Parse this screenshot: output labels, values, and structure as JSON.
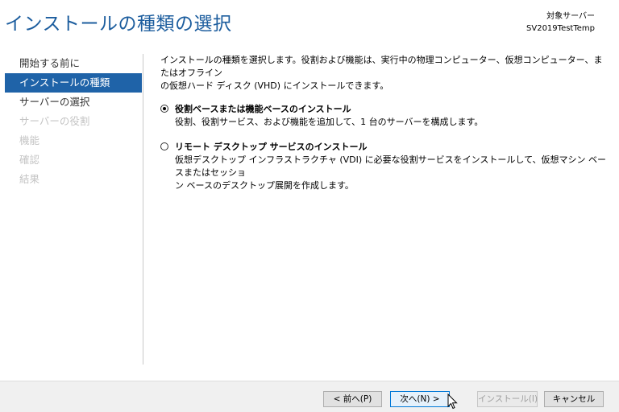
{
  "header": {
    "title": "インストールの種類の選択",
    "destination_label": "対象サーバー",
    "destination_server": "SV2019TestTemp"
  },
  "nav": {
    "items": [
      {
        "label": "開始する前に",
        "state": "normal"
      },
      {
        "label": "インストールの種類",
        "state": "active"
      },
      {
        "label": "サーバーの選択",
        "state": "normal"
      },
      {
        "label": "サーバーの役割",
        "state": "disabled"
      },
      {
        "label": "機能",
        "state": "disabled"
      },
      {
        "label": "確認",
        "state": "disabled"
      },
      {
        "label": "結果",
        "state": "disabled"
      }
    ]
  },
  "main": {
    "intro_line1": "インストールの種類を選択します。役割および機能は、実行中の物理コンピューター、仮想コンピューター、またはオフライン",
    "intro_line2": "の仮想ハード ディスク (VHD) にインストールできます。",
    "options": [
      {
        "title": "役割ベースまたは機能ベースのインストール",
        "desc_line1": "役割、役割サービス、および機能を追加して、1 台のサーバーを構成します。",
        "desc_line2": "",
        "selected": true
      },
      {
        "title": "リモート デスクトップ サービスのインストール",
        "desc_line1": "仮想デスクトップ インフラストラクチャ (VDI) に必要な役割サービスをインストールして、仮想マシン ベースまたはセッショ",
        "desc_line2": "ン ベースのデスクトップ展開を作成します。",
        "selected": false
      }
    ]
  },
  "footer": {
    "prev_label": "< 前へ(P)",
    "next_label": "次へ(N) >",
    "install_label": "インストール(I)",
    "cancel_label": "キャンセル"
  },
  "colors": {
    "title": "#1c5d9e",
    "nav_active_bg": "#1f63a8",
    "disabled_text": "#c4c4c4"
  }
}
